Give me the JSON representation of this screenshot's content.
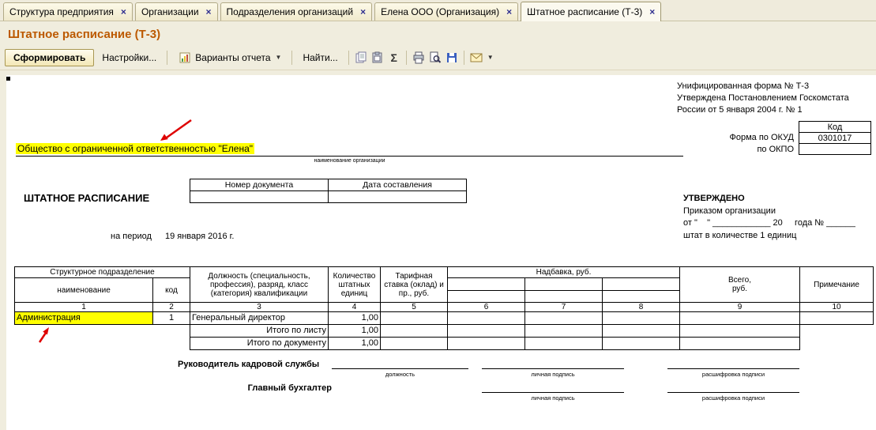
{
  "tabs": [
    {
      "label": "Структура предприятия"
    },
    {
      "label": "Организации"
    },
    {
      "label": "Подразделения организаций"
    },
    {
      "label": "Елена ООО (Организация)"
    },
    {
      "label": "Штатное расписание (Т-3)"
    }
  ],
  "page_title": "Штатное расписание (Т-3)",
  "toolbar": {
    "generate": "Сформировать",
    "settings": "Настройки...",
    "variants": "Варианты отчета",
    "find": "Найти...",
    "sigma": "Σ"
  },
  "form": {
    "info1": "Унифицированная форма № Т-3",
    "info2": "Утверждена Постановлением Госкомстата",
    "info3": "России от 5 января 2004 г. № 1",
    "code_title": "Код",
    "okud_label": "Форма по ОКУД",
    "okud_value": "0301017",
    "okpo_label": "по ОКПО",
    "org_name": "Общество с ограниченной ответственностью \"Елена\"",
    "org_caption": "наименование организации",
    "doc_title": "ШТАТНОЕ РАСПИСАНИЕ",
    "doc_num_header": "Номер документа",
    "doc_date_header": "Дата составления",
    "approved_title": "УТВЕРЖДЕНО",
    "approved_line1": "Приказом организации",
    "approved_line2": "от \"    \" ____________ 20     года № ______",
    "approved_line3": "штат в количестве 1 единиц",
    "period_label": "на период",
    "period_value": "19 января 2016 г."
  },
  "table": {
    "h_structural": "Структурное  подразделение",
    "h_name": "наименование",
    "h_code": "код",
    "h_position": "Должность (специальность, профессия), разряд, класс (категория) квалификации",
    "h_count": "Количество штатных единиц",
    "h_rate": "Тарифная ставка (оклад) и пр., руб.",
    "h_allowance": "Надбавка, руб.",
    "h_total": "Всего,\nруб.",
    "h_note": "Примечание",
    "nums": [
      "1",
      "2",
      "3",
      "4",
      "5",
      "6",
      "7",
      "8",
      "9",
      "10"
    ],
    "row": {
      "name": "Администрация",
      "code": "1",
      "position": "Генеральный директор",
      "count": "1,00"
    },
    "total_sheet_label": "Итого по листу",
    "total_sheet_value": "1,00",
    "total_doc_label": "Итого по документу",
    "total_doc_value": "1,00"
  },
  "signatures": {
    "hr_label": "Руководитель кадровой службы",
    "accountant_label": "Главный бухгалтер",
    "position_caption": "должность",
    "sign_caption": "личная подпись",
    "name_caption": "расшифровка подписи"
  }
}
